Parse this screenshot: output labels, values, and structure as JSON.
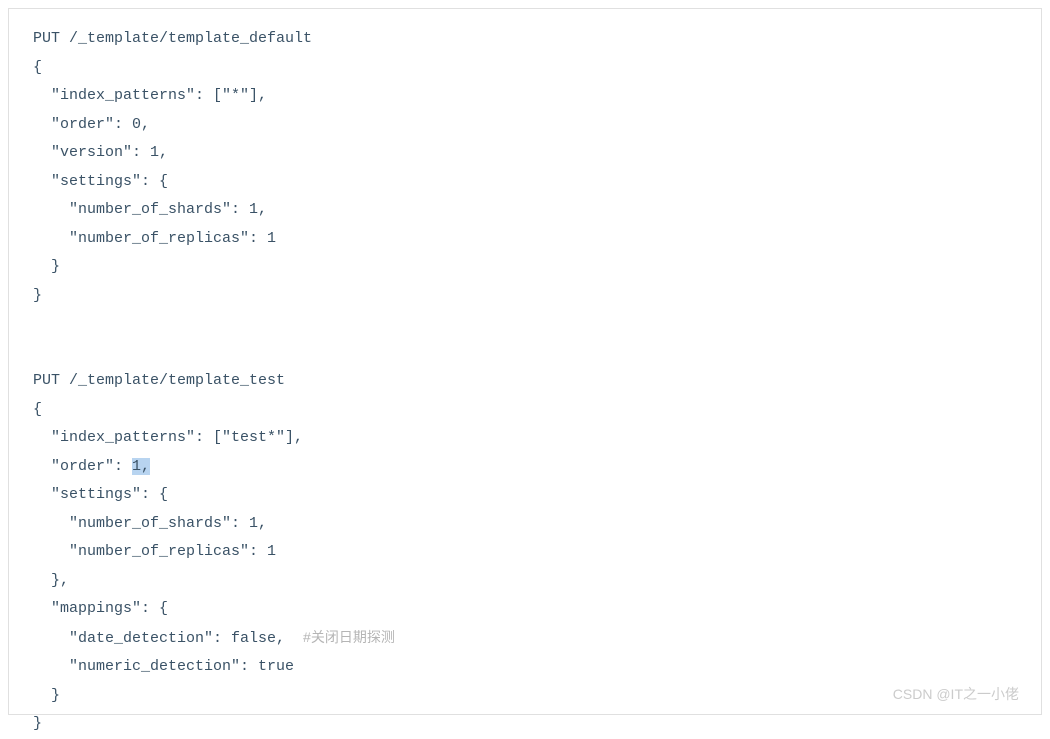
{
  "code": {
    "block1": {
      "l1": "PUT /_template/template_default",
      "l2": "{",
      "l3": "  \"index_patterns\": [\"*\"],",
      "l4": "  \"order\": 0,",
      "l5": "  \"version\": 1,",
      "l6": "  \"settings\": {",
      "l7": "    \"number_of_shards\": 1,",
      "l8": "    \"number_of_replicas\": 1",
      "l9": "  }",
      "l10": "}"
    },
    "block2": {
      "l1": "PUT /_template/template_test",
      "l2": "{",
      "l3": "  \"index_patterns\": [\"test*\"],",
      "l4_pre": "  \"order\"",
      "l4_caret": ":",
      "l4_sp": " ",
      "l4_hl": "1,",
      "l5": "  \"settings\": {",
      "l6": "    \"number_of_shards\": 1,",
      "l7": "    \"number_of_replicas\": 1",
      "l8": "  },",
      "l9": "  \"mappings\": {",
      "l10_code": "    \"date_detection\": false,  ",
      "l10_comment": "#关闭日期探测",
      "l11": "    \"numeric_detection\": true",
      "l12": "  }",
      "l13": "}"
    }
  },
  "watermark": "CSDN @IT之一小佬"
}
